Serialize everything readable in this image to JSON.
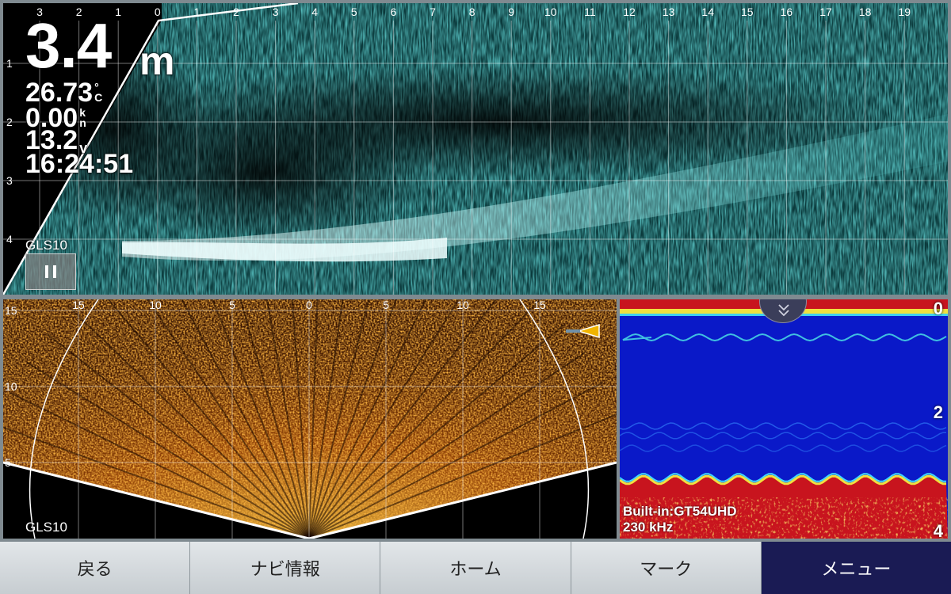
{
  "side_scan": {
    "depth_value": "3.4",
    "depth_unit": "m",
    "water_temp": "26.73",
    "water_temp_unit": "°C",
    "speed": "0.00",
    "speed_unit": "kn",
    "voltage": "13.2",
    "voltage_unit": "v",
    "time": "16:24:51",
    "source": "GLS10",
    "pause_icon": "pause-icon",
    "range_ticks": [
      "3",
      "2",
      "1",
      "0",
      "1",
      "2",
      "3",
      "4",
      "5",
      "6",
      "7",
      "8",
      "9",
      "10",
      "11",
      "12",
      "13",
      "14",
      "15",
      "16",
      "17",
      "18",
      "19"
    ],
    "depth_ticks": [
      "1",
      "2",
      "3",
      "4"
    ],
    "echo_color": "#3cc8c8"
  },
  "live_sonar": {
    "source": "GLS10",
    "range_ticks": [
      "15",
      "10",
      "5",
      "0",
      "5",
      "10",
      "15"
    ],
    "depth_ticks": [
      "15",
      "10",
      "5"
    ],
    "echo_color": "#e07810"
  },
  "fish_finder": {
    "scale_top": "0",
    "scale_mid": "2",
    "scale_bottom": "4",
    "transducer": "Built-in:GT54UHD",
    "frequency": "230 kHz",
    "collapse_icon": "chevron-double-down-icon",
    "background_color": "#0a19c8",
    "bottom_color": "#c8141e"
  },
  "nav": {
    "back": "戻る",
    "nav_info": "ナビ情報",
    "home": "ホーム",
    "mark": "マーク",
    "menu": "メニュー"
  }
}
